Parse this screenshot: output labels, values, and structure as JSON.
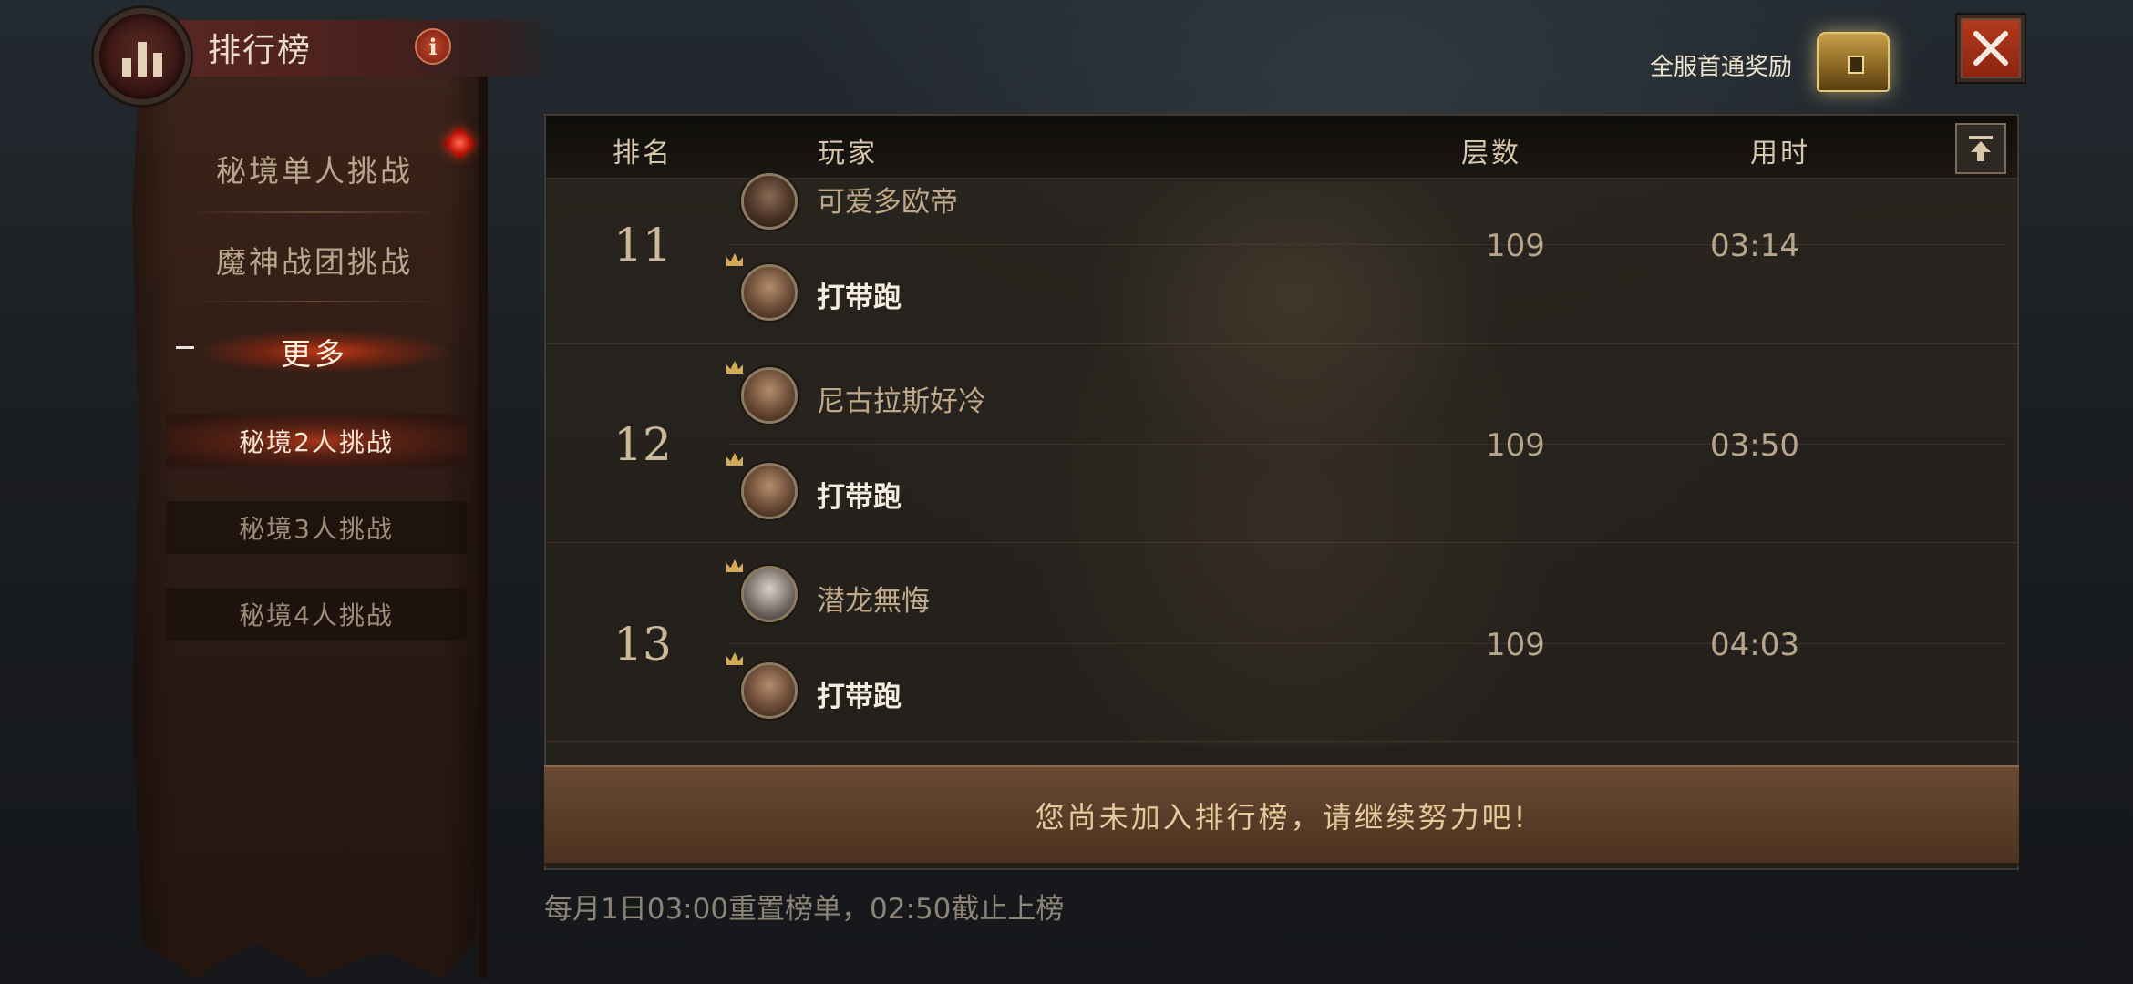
{
  "header": {
    "title": "排行榜",
    "info_label": "i"
  },
  "sidebar": {
    "items": [
      {
        "label": "秘境单人挑战"
      },
      {
        "label": "魔神战团挑战"
      },
      {
        "label": "更多"
      }
    ],
    "sub_items": [
      {
        "label": "秘境2人挑战",
        "active": true
      },
      {
        "label": "秘境3人挑战",
        "active": false
      },
      {
        "label": "秘境4人挑战",
        "active": false
      }
    ]
  },
  "reward": {
    "label": "全服首通奖励",
    "icon": "treasure-chest-icon"
  },
  "close": {
    "icon": "close-icon"
  },
  "table": {
    "columns": [
      "排名",
      "玩家",
      "层数",
      "用时"
    ],
    "rows": [
      {
        "rank": "11",
        "players": [
          "可爱多欧帝",
          "打带跑"
        ],
        "layers": "109",
        "time": "03:14"
      },
      {
        "rank": "12",
        "players": [
          "尼古拉斯好冷",
          "打带跑"
        ],
        "layers": "109",
        "time": "03:50"
      },
      {
        "rank": "13",
        "players": [
          "潜龙無悔",
          "打带跑"
        ],
        "layers": "109",
        "time": "04:03"
      }
    ]
  },
  "notice": "您尚未加入排行榜，请继续努力吧!",
  "footer": "每月1日03:00重置榜单，02:50截止上榜",
  "colors": {
    "accent_red": "#b33a1d",
    "menu_active": "#af3719",
    "notice_bg": "#5a3d29"
  }
}
